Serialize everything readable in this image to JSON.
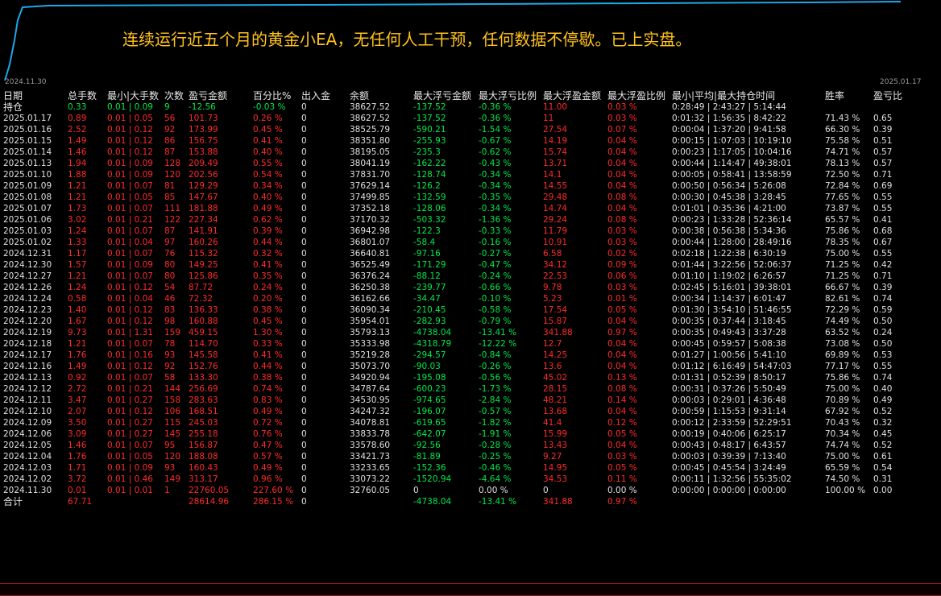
{
  "banner": "连续运行近五个月的黄金小EA，无任何人工干预，任何数据不停歇。已上实盘。",
  "chart_dates": {
    "start": "2024.11.30",
    "end": "2025.01.17"
  },
  "colors": {
    "profit": "#ff2a2a",
    "loss": "#00e94a",
    "banner": "#ffc21a",
    "equity_line": "#1ea7e8",
    "text": "#e0e0e0"
  },
  "headers": {
    "date": "日期",
    "lots": "总手数",
    "minmax": "最小|大手数",
    "count": "次数",
    "pnl": "盈亏金额",
    "pct": "百分比%",
    "deposit": "出入金",
    "balance": "余额",
    "max_float_loss": "最大浮亏金额",
    "max_float_loss_pct": "最大浮亏比例",
    "max_float_profit": "最大浮盈金额",
    "max_float_profit_pct": "最大浮盈比例",
    "hold_time": "最小|平均|最大持仓时间",
    "winrate": "胜率",
    "pf": "盈亏比"
  },
  "holding": {
    "label": "持仓",
    "lots": "0.33",
    "minmax": "0.01 | 0.09",
    "count": "9",
    "pnl": "-12.56",
    "pct": "-0.03 %",
    "deposit": "0",
    "balance": "38627.52",
    "mfl": "-137.52",
    "mflp": "-0.36 %",
    "mfp": "11.00",
    "mfpp": "0.03 %",
    "time": "0:28:49 | 2:43:27 | 5:14:44",
    "win": "",
    "pf": ""
  },
  "rows": [
    [
      "2025.01.17",
      "0.89",
      "0.01 | 0.05",
      "56",
      "101.73",
      "0.26 %",
      "0",
      "38627.52",
      "-137.52",
      "-0.36 %",
      "11",
      "0.03 %",
      "0:01:32 | 1:56:35 | 8:42:22",
      "71.43 %",
      "0.65"
    ],
    [
      "2025.01.16",
      "2.52",
      "0.01 | 0.12",
      "92",
      "173.99",
      "0.45 %",
      "0",
      "38525.79",
      "-590.21",
      "-1.54 %",
      "27.54",
      "0.07 %",
      "0:00:04 | 1:37:20 | 9:41:58",
      "66.30 %",
      "0.39"
    ],
    [
      "2025.01.15",
      "1.49",
      "0.01 | 0.12",
      "86",
      "156.75",
      "0.41 %",
      "0",
      "38351.80",
      "-255.93",
      "-0.67 %",
      "14.19",
      "0.04 %",
      "0:00:15 | 1:07:03 | 10:19:10",
      "75.58 %",
      "0.51"
    ],
    [
      "2025.01.14",
      "1.46",
      "0.01 | 0.12",
      "87",
      "153.88",
      "0.40 %",
      "0",
      "38195.05",
      "-235.3",
      "-0.62 %",
      "15.74",
      "0.04 %",
      "0:00:23 | 1:17:05 | 10:04:16",
      "74.71 %",
      "0.57"
    ],
    [
      "2025.01.13",
      "1.94",
      "0.01 | 0.09",
      "128",
      "209.49",
      "0.55 %",
      "0",
      "38041.19",
      "-162.22",
      "-0.43 %",
      "13.71",
      "0.04 %",
      "0:00:44 | 1:14:47 | 49:38:01",
      "78.13 %",
      "0.57"
    ],
    [
      "2025.01.10",
      "1.88",
      "0.01 | 0.09",
      "120",
      "202.56",
      "0.54 %",
      "0",
      "37831.70",
      "-128.74",
      "-0.34 %",
      "14.1",
      "0.04 %",
      "0:00:05 | 0:58:41 | 13:58:59",
      "72.50 %",
      "0.71"
    ],
    [
      "2025.01.09",
      "1.21",
      "0.01 | 0.07",
      "81",
      "129.29",
      "0.34 %",
      "0",
      "37629.14",
      "-126.2",
      "-0.34 %",
      "14.55",
      "0.04 %",
      "0:00:50 | 0:56:34 | 5:26:08",
      "72.84 %",
      "0.69"
    ],
    [
      "2025.01.08",
      "1.21",
      "0.01 | 0.05",
      "85",
      "147.67",
      "0.40 %",
      "0",
      "37499.85",
      "-132.59",
      "-0.35 %",
      "29.48",
      "0.08 %",
      "0:00:30 | 0:45:38 | 3:28:45",
      "77.65 %",
      "0.55"
    ],
    [
      "2025.01.07",
      "1.73",
      "0.01 | 0.07",
      "111",
      "181.88",
      "0.49 %",
      "0",
      "37352.18",
      "-128.06",
      "-0.34 %",
      "14.74",
      "0.04 %",
      "0:01:01 | 0:35:36 | 4:21:00",
      "73.87 %",
      "0.55"
    ],
    [
      "2025.01.06",
      "3.02",
      "0.01 | 0.21",
      "122",
      "227.34",
      "0.62 %",
      "0",
      "37170.32",
      "-503.32",
      "-1.36 %",
      "29.24",
      "0.08 %",
      "0:00:23 | 1:33:28 | 52:36:14",
      "65.57 %",
      "0.41"
    ],
    [
      "2025.01.03",
      "1.24",
      "0.01 | 0.07",
      "87",
      "141.91",
      "0.39 %",
      "0",
      "36942.98",
      "-122.3",
      "-0.33 %",
      "11.79",
      "0.03 %",
      "0:00:38 | 0:56:38 | 5:34:36",
      "75.86 %",
      "0.68"
    ],
    [
      "2025.01.02",
      "1.33",
      "0.01 | 0.04",
      "97",
      "160.26",
      "0.44 %",
      "0",
      "36801.07",
      "-58.4",
      "-0.16 %",
      "10.91",
      "0.03 %",
      "0:00:44 | 1:28:00 | 28:49:16",
      "78.35 %",
      "0.67"
    ],
    [
      "2024.12.31",
      "1.17",
      "0.01 | 0.07",
      "76",
      "115.32",
      "0.32 %",
      "0",
      "36640.81",
      "-97.16",
      "-0.27 %",
      "6.58",
      "0.02 %",
      "0:02:18 | 1:22:38 | 6:30:19",
      "75.00 %",
      "0.55"
    ],
    [
      "2024.12.30",
      "1.57",
      "0.01 | 0.09",
      "80",
      "149.25",
      "0.41 %",
      "0",
      "36525.49",
      "-171.29",
      "-0.47 %",
      "34.12",
      "0.09 %",
      "0:01:44 | 3:22:56 | 52:06:37",
      "71.25 %",
      "0.42"
    ],
    [
      "2024.12.27",
      "1.21",
      "0.01 | 0.07",
      "80",
      "125.86",
      "0.35 %",
      "0",
      "36376.24",
      "-88.12",
      "-0.24 %",
      "22.53",
      "0.06 %",
      "0:01:10 | 1:19:02 | 6:26:57",
      "71.25 %",
      "0.71"
    ],
    [
      "2024.12.26",
      "1.24",
      "0.01 | 0.12",
      "54",
      "87.72",
      "0.24 %",
      "0",
      "36250.38",
      "-239.77",
      "-0.66 %",
      "9.78",
      "0.03 %",
      "0:02:45 | 5:16:01 | 39:38:01",
      "66.67 %",
      "0.39"
    ],
    [
      "2024.12.24",
      "0.58",
      "0.01 | 0.04",
      "46",
      "72.32",
      "0.20 %",
      "0",
      "36162.66",
      "-34.47",
      "-0.10 %",
      "5.23",
      "0.01 %",
      "0:00:34 | 1:14:37 | 6:01:47",
      "82.61 %",
      "0.74"
    ],
    [
      "2024.12.23",
      "1.40",
      "0.01 | 0.12",
      "83",
      "136.33",
      "0.38 %",
      "0",
      "36090.34",
      "-210.45",
      "-0.58 %",
      "17.54",
      "0.05 %",
      "0:01:30 | 3:54:10 | 51:46:55",
      "72.29 %",
      "0.59"
    ],
    [
      "2024.12.20",
      "1.67",
      "0.01 | 0.12",
      "98",
      "160.88",
      "0.45 %",
      "0",
      "35954.01",
      "-282.93",
      "-0.79 %",
      "15.87",
      "0.04 %",
      "0:00:35 | 0:37:44 | 3:18:45",
      "74.49 %",
      "0.50"
    ],
    [
      "2024.12.19",
      "9.73",
      "0.01 | 1.31",
      "159",
      "459.15",
      "1.30 %",
      "0",
      "35793.13",
      "-4738.04",
      "-13.41 %",
      "341.88",
      "0.97 %",
      "0:00:35 | 0:49:43 | 3:37:28",
      "63.52 %",
      "0.24"
    ],
    [
      "2024.12.18",
      "1.21",
      "0.01 | 0.07",
      "78",
      "114.70",
      "0.33 %",
      "0",
      "35333.98",
      "-4318.79",
      "-12.22 %",
      "12.7",
      "0.04 %",
      "0:00:45 | 0:59:57 | 5:08:38",
      "73.08 %",
      "0.50"
    ],
    [
      "2024.12.17",
      "1.76",
      "0.01 | 0.16",
      "93",
      "145.58",
      "0.41 %",
      "0",
      "35219.28",
      "-294.57",
      "-0.84 %",
      "14.25",
      "0.04 %",
      "0:01:27 | 1:00:56 | 5:41:10",
      "69.89 %",
      "0.53"
    ],
    [
      "2024.12.16",
      "1.49",
      "0.01 | 0.12",
      "92",
      "152.76",
      "0.44 %",
      "0",
      "35073.70",
      "-90.03",
      "-0.26 %",
      "13.6",
      "0.04 %",
      "0:01:12 | 6:16:49 | 54:47:03",
      "77.17 %",
      "0.55"
    ],
    [
      "2024.12.13",
      "0.92",
      "0.01 | 0.07",
      "58",
      "133.30",
      "0.38 %",
      "0",
      "34920.94",
      "-195.08",
      "-0.56 %",
      "45.02",
      "0.13 %",
      "0:01:31 | 0:52:39 | 8:50:17",
      "75.86 %",
      "0.74"
    ],
    [
      "2024.12.12",
      "2.72",
      "0.01 | 0.21",
      "144",
      "256.69",
      "0.74 %",
      "0",
      "34787.64",
      "-600.23",
      "-1.73 %",
      "28.15",
      "0.08 %",
      "0:00:31 | 0:37:26 | 5:50:49",
      "75.00 %",
      "0.40"
    ],
    [
      "2024.12.11",
      "3.47",
      "0.01 | 0.27",
      "158",
      "283.63",
      "0.83 %",
      "0",
      "34530.95",
      "-974.65",
      "-2.84 %",
      "48.21",
      "0.14 %",
      "0:00:03 | 0:29:01 | 4:36:48",
      "70.89 %",
      "0.49"
    ],
    [
      "2024.12.10",
      "2.07",
      "0.01 | 0.12",
      "106",
      "168.51",
      "0.49 %",
      "0",
      "34247.32",
      "-196.07",
      "-0.57 %",
      "13.68",
      "0.04 %",
      "0:00:59 | 1:15:53 | 9:31:14",
      "67.92 %",
      "0.52"
    ],
    [
      "2024.12.09",
      "3.50",
      "0.01 | 0.27",
      "115",
      "245.03",
      "0.72 %",
      "0",
      "34078.81",
      "-619.65",
      "-1.82 %",
      "41.4",
      "0.12 %",
      "0:00:12 | 2:33:59 | 52:29:51",
      "70.43 %",
      "0.32"
    ],
    [
      "2024.12.06",
      "3.09",
      "0.01 | 0.27",
      "145",
      "255.18",
      "0.76 %",
      "0",
      "33833.78",
      "-642.07",
      "-1.91 %",
      "15.99",
      "0.05 %",
      "0:00:19 | 0:40:06 | 6:25:17",
      "70.34 %",
      "0.45"
    ],
    [
      "2024.12.05",
      "1.46",
      "0.01 | 0.07",
      "95",
      "156.87",
      "0.47 %",
      "0",
      "33578.60",
      "-92.56",
      "-0.28 %",
      "13.43",
      "0.04 %",
      "0:00:43 | 0:48:17 | 6:43:57",
      "74.74 %",
      "0.52"
    ],
    [
      "2024.12.04",
      "1.76",
      "0.01 | 0.05",
      "120",
      "188.08",
      "0.57 %",
      "0",
      "33421.73",
      "-81.89",
      "-0.25 %",
      "9.27",
      "0.03 %",
      "0:00:03 | 0:39:39 | 7:13:40",
      "75.00 %",
      "0.61"
    ],
    [
      "2024.12.03",
      "1.71",
      "0.01 | 0.09",
      "93",
      "160.43",
      "0.49 %",
      "0",
      "33233.65",
      "-152.36",
      "-0.46 %",
      "14.95",
      "0.05 %",
      "0:00:45 | 0:45:54 | 3:24:49",
      "65.59 %",
      "0.54"
    ],
    [
      "2024.12.02",
      "3.72",
      "0.01 | 0.46",
      "149",
      "313.17",
      "0.96 %",
      "0",
      "33073.22",
      "-1520.94",
      "-4.64 %",
      "34.53",
      "0.11 %",
      "0:00:11 | 1:32:56 | 55:35:02",
      "74.50 %",
      "0.31"
    ],
    [
      "2024.11.30",
      "0.01",
      "0.01 | 0.01",
      "1",
      "22760.05",
      "227.60 %",
      "0",
      "32760.05",
      "0",
      "0.00 %",
      "0",
      "0.00 %",
      "0:00:00 | 0:00:00 | 0:00:00",
      "100.00 %",
      "0.00"
    ]
  ],
  "total": {
    "label": "合计",
    "lots": "67.71",
    "pnl": "28614.96",
    "pct": "286.15 %",
    "deposit": "0",
    "mfl": "-4738.04",
    "mflp": "-13.41 %",
    "mfp": "341.88",
    "mfpp": "0.97 %"
  }
}
